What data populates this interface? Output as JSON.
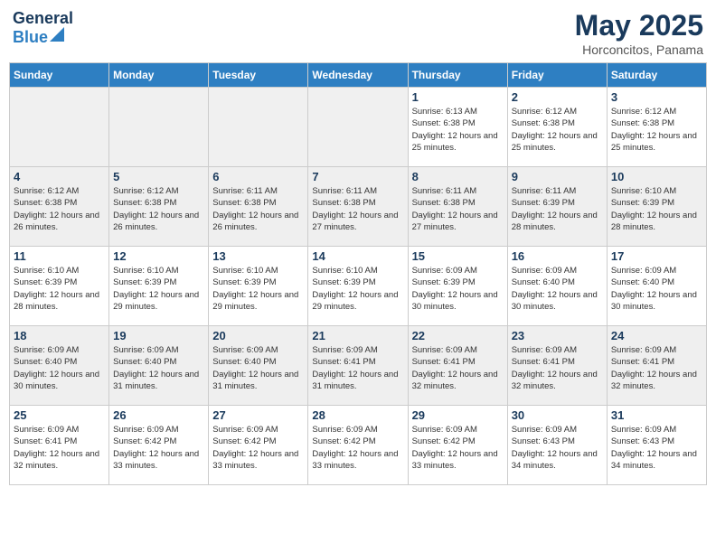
{
  "logo": {
    "general": "General",
    "blue": "Blue"
  },
  "title": "May 2025",
  "location": "Horconcitos, Panama",
  "days_of_week": [
    "Sunday",
    "Monday",
    "Tuesday",
    "Wednesday",
    "Thursday",
    "Friday",
    "Saturday"
  ],
  "weeks": [
    [
      {
        "num": "",
        "empty": true
      },
      {
        "num": "",
        "empty": true
      },
      {
        "num": "",
        "empty": true
      },
      {
        "num": "",
        "empty": true
      },
      {
        "num": "1",
        "sunrise": "6:13 AM",
        "sunset": "6:38 PM",
        "daylight": "12 hours and 25 minutes."
      },
      {
        "num": "2",
        "sunrise": "6:12 AM",
        "sunset": "6:38 PM",
        "daylight": "12 hours and 25 minutes."
      },
      {
        "num": "3",
        "sunrise": "6:12 AM",
        "sunset": "6:38 PM",
        "daylight": "12 hours and 25 minutes."
      }
    ],
    [
      {
        "num": "4",
        "sunrise": "6:12 AM",
        "sunset": "6:38 PM",
        "daylight": "12 hours and 26 minutes."
      },
      {
        "num": "5",
        "sunrise": "6:12 AM",
        "sunset": "6:38 PM",
        "daylight": "12 hours and 26 minutes."
      },
      {
        "num": "6",
        "sunrise": "6:11 AM",
        "sunset": "6:38 PM",
        "daylight": "12 hours and 26 minutes."
      },
      {
        "num": "7",
        "sunrise": "6:11 AM",
        "sunset": "6:38 PM",
        "daylight": "12 hours and 27 minutes."
      },
      {
        "num": "8",
        "sunrise": "6:11 AM",
        "sunset": "6:38 PM",
        "daylight": "12 hours and 27 minutes."
      },
      {
        "num": "9",
        "sunrise": "6:11 AM",
        "sunset": "6:39 PM",
        "daylight": "12 hours and 28 minutes."
      },
      {
        "num": "10",
        "sunrise": "6:10 AM",
        "sunset": "6:39 PM",
        "daylight": "12 hours and 28 minutes."
      }
    ],
    [
      {
        "num": "11",
        "sunrise": "6:10 AM",
        "sunset": "6:39 PM",
        "daylight": "12 hours and 28 minutes."
      },
      {
        "num": "12",
        "sunrise": "6:10 AM",
        "sunset": "6:39 PM",
        "daylight": "12 hours and 29 minutes."
      },
      {
        "num": "13",
        "sunrise": "6:10 AM",
        "sunset": "6:39 PM",
        "daylight": "12 hours and 29 minutes."
      },
      {
        "num": "14",
        "sunrise": "6:10 AM",
        "sunset": "6:39 PM",
        "daylight": "12 hours and 29 minutes."
      },
      {
        "num": "15",
        "sunrise": "6:09 AM",
        "sunset": "6:39 PM",
        "daylight": "12 hours and 30 minutes."
      },
      {
        "num": "16",
        "sunrise": "6:09 AM",
        "sunset": "6:40 PM",
        "daylight": "12 hours and 30 minutes."
      },
      {
        "num": "17",
        "sunrise": "6:09 AM",
        "sunset": "6:40 PM",
        "daylight": "12 hours and 30 minutes."
      }
    ],
    [
      {
        "num": "18",
        "sunrise": "6:09 AM",
        "sunset": "6:40 PM",
        "daylight": "12 hours and 30 minutes."
      },
      {
        "num": "19",
        "sunrise": "6:09 AM",
        "sunset": "6:40 PM",
        "daylight": "12 hours and 31 minutes."
      },
      {
        "num": "20",
        "sunrise": "6:09 AM",
        "sunset": "6:40 PM",
        "daylight": "12 hours and 31 minutes."
      },
      {
        "num": "21",
        "sunrise": "6:09 AM",
        "sunset": "6:41 PM",
        "daylight": "12 hours and 31 minutes."
      },
      {
        "num": "22",
        "sunrise": "6:09 AM",
        "sunset": "6:41 PM",
        "daylight": "12 hours and 32 minutes."
      },
      {
        "num": "23",
        "sunrise": "6:09 AM",
        "sunset": "6:41 PM",
        "daylight": "12 hours and 32 minutes."
      },
      {
        "num": "24",
        "sunrise": "6:09 AM",
        "sunset": "6:41 PM",
        "daylight": "12 hours and 32 minutes."
      }
    ],
    [
      {
        "num": "25",
        "sunrise": "6:09 AM",
        "sunset": "6:41 PM",
        "daylight": "12 hours and 32 minutes."
      },
      {
        "num": "26",
        "sunrise": "6:09 AM",
        "sunset": "6:42 PM",
        "daylight": "12 hours and 33 minutes."
      },
      {
        "num": "27",
        "sunrise": "6:09 AM",
        "sunset": "6:42 PM",
        "daylight": "12 hours and 33 minutes."
      },
      {
        "num": "28",
        "sunrise": "6:09 AM",
        "sunset": "6:42 PM",
        "daylight": "12 hours and 33 minutes."
      },
      {
        "num": "29",
        "sunrise": "6:09 AM",
        "sunset": "6:42 PM",
        "daylight": "12 hours and 33 minutes."
      },
      {
        "num": "30",
        "sunrise": "6:09 AM",
        "sunset": "6:43 PM",
        "daylight": "12 hours and 34 minutes."
      },
      {
        "num": "31",
        "sunrise": "6:09 AM",
        "sunset": "6:43 PM",
        "daylight": "12 hours and 34 minutes."
      }
    ]
  ]
}
